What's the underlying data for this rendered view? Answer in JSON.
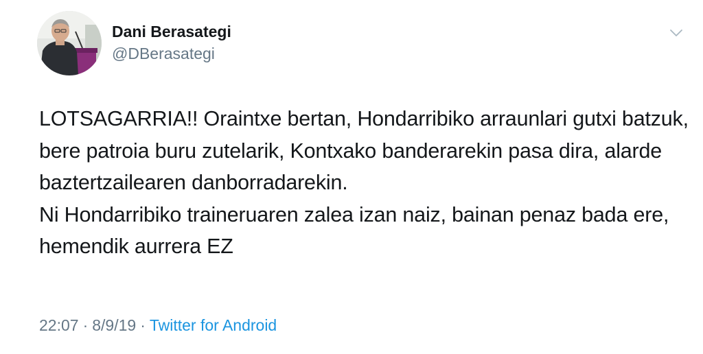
{
  "tweet": {
    "author": {
      "display_name": "Dani Berasategi",
      "handle": "@DBerasategi",
      "avatar": "avatar-photo-speaker-at-podium"
    },
    "menu_icon": "chevron-down-icon",
    "text": "LOTSAGARRIA!! Oraintxe bertan, Hondarribiko arraunlari gutxi batzuk, bere patroia buru zutelarik, Kontxako banderarekin pasa dira, alarde baztertzailearen danborradarekin.\nNi Hondarribiko traineruaren zalea izan naiz, bainan penaz bada ere, hemendik aurrera EZ",
    "meta": {
      "time": "22:07",
      "date": "8/9/19",
      "separator": "·",
      "source": "Twitter for Android"
    }
  },
  "colors": {
    "text": "#14171a",
    "secondary": "#657786",
    "link": "#1b95e0",
    "background": "#ffffff"
  }
}
